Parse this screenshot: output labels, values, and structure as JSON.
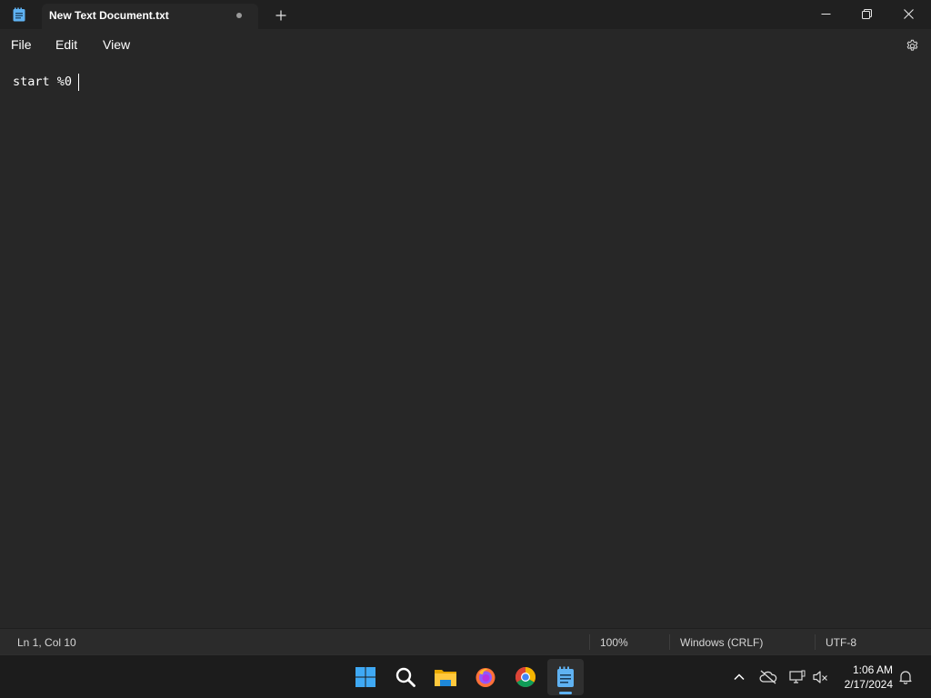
{
  "window": {
    "tab_title": "New Text Document.txt",
    "tab_unsaved_indicator": "dot",
    "new_tab_icon": "plus-icon",
    "controls": [
      "minimize-icon",
      "maximize-icon",
      "close-icon"
    ]
  },
  "menu": {
    "file": "File",
    "edit": "Edit",
    "view": "View",
    "settings_icon": "gear-icon"
  },
  "editor": {
    "content": "start %0 "
  },
  "status": {
    "position": "Ln 1, Col 10",
    "zoom": "100%",
    "line_ending": "Windows (CRLF)",
    "encoding": "UTF-8"
  },
  "taskbar": {
    "apps": [
      "windows-start-icon",
      "search-icon",
      "file-explorer-icon",
      "firefox-icon",
      "chrome-icon",
      "notepad-icon"
    ],
    "active_app": "notepad-icon",
    "tray": [
      "chevron-up-icon",
      "onedrive-offline-icon",
      "network-icon",
      "volume-muted-icon",
      "bell-icon"
    ],
    "time": "1:06 AM",
    "date": "2/17/2024"
  },
  "colors": {
    "background": "#202020",
    "editor_background": "#272727",
    "accent": "#5fb2f2"
  }
}
